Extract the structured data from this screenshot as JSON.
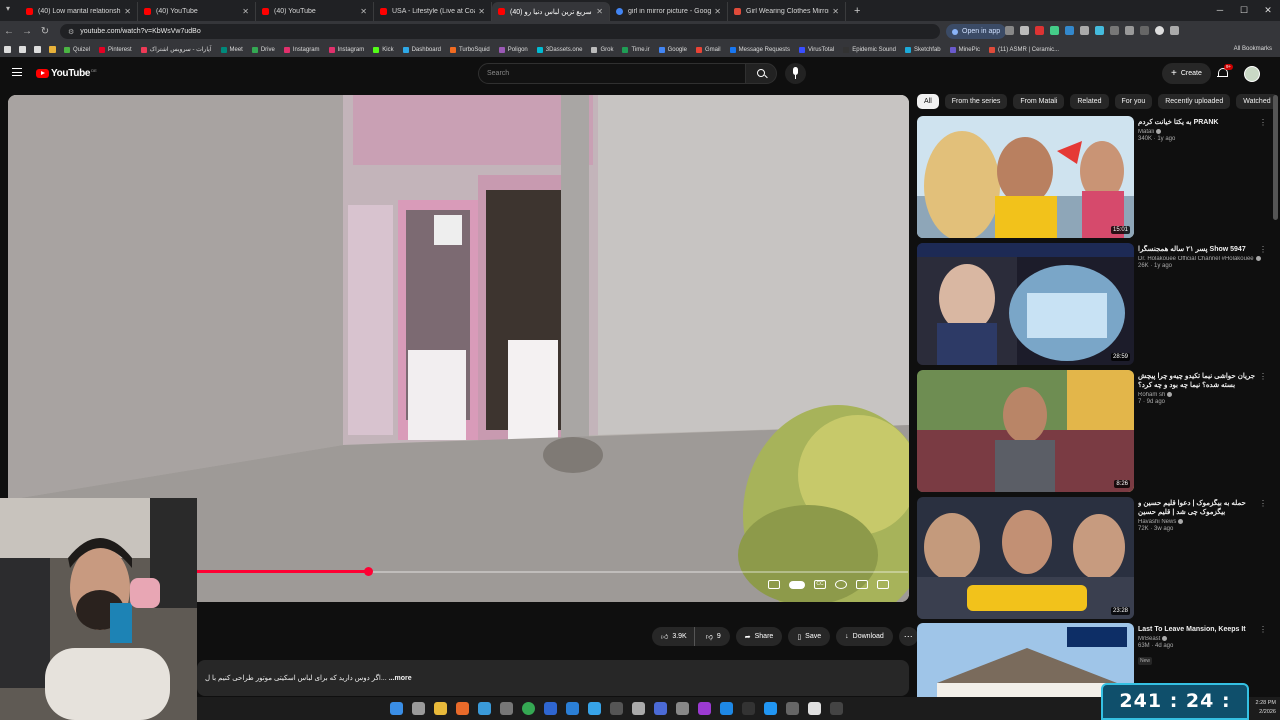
{
  "browser": {
    "tabs": [
      {
        "title": "(40) Low marital relationsh",
        "kind": "yt"
      },
      {
        "title": "(40) YouTube",
        "kind": "yt"
      },
      {
        "title": "(40) YouTube",
        "kind": "yt"
      },
      {
        "title": "USA - Lifestyle (Live at Coachel",
        "kind": "yt"
      },
      {
        "title": "(40) سریع ترین لباس دنیا رو",
        "kind": "yt",
        "active": true
      },
      {
        "title": "girl in mirror picture - Google",
        "kind": "g"
      },
      {
        "title": "Girl Wearing Clothes Mirror Sel",
        "kind": "w"
      }
    ],
    "url": "youtube.com/watch?v=KbWsVw7udBo",
    "open_in_app": "Open in app",
    "bookmarks": [
      "Quizel",
      "Pinterest",
      "آپارات - سرویس اشتراک",
      "Meet",
      "Drive",
      "Instagram",
      "Instagram",
      "Kick",
      "Dashboard",
      "TurboSquid",
      "Poligon",
      "3Dassets.one",
      "Grok",
      "Time.ir",
      "Google",
      "Gmail",
      "Message Requests",
      "VirusTotal",
      "Epidemic Sound",
      "Sketchfab",
      "MinePic",
      "(11) ASMR | Ceramic..."
    ],
    "all_bookmarks": "All Bookmarks"
  },
  "youtube": {
    "logo": "YouTube",
    "logo_country": "DE",
    "search_placeholder": "Search",
    "create_label": "Create",
    "notifications": "9+"
  },
  "video": {
    "progress_fraction": 0.24,
    "likes": "3.9K",
    "dislikes": "9",
    "share": "Share",
    "save": "Save",
    "download": "Download",
    "description": "اگر دوس دارید که برای لباس اسکیتی موتور طراحی کنیم با ل...",
    "more": "...more"
  },
  "sidebar": {
    "chips": [
      "All",
      "From the series",
      "From Matali",
      "Related",
      "For you",
      "Recently uploaded",
      "Watched"
    ],
    "recommendations": [
      {
        "title": "به یکتا خیانت کردم PRANK",
        "channel": "Matali",
        "stats": "340K  ·  1y ago",
        "duration": "15:01"
      },
      {
        "title": "پسر ۲۱ ساله همجنسگرا Show 5947",
        "channel": "Dr. Holakouee Official Channel #Holakouee",
        "stats": "26K  ·  1y ago",
        "duration": "28:59"
      },
      {
        "title": "جریان حواشی نیما تکیدو چیه‌و چرا پیچش بسته شده؟ نیما چه بود و چه کرد؟",
        "channel": "Roham sh",
        "stats": "7  ·  9d ago",
        "duration": "8:26"
      },
      {
        "title": "حمله به بیگزموک | دعوا قلیم حسین و بیگزموک چی شد | قلیم حسین",
        "channel": "Havashi News",
        "stats": "72K  ·  3w ago",
        "duration": "23:28"
      },
      {
        "title": "Last To Leave Mansion, Keeps It",
        "channel": "MrBeast",
        "stats": "63M  ·  4d ago",
        "duration": "",
        "badge": "New"
      }
    ]
  },
  "timer": "241 : 24 : 49",
  "taskbar": {
    "time": "2:28 PM",
    "date": "2/2026"
  },
  "colors": {
    "accent_red": "#ff0033",
    "timer_bg": "#0f4f6b",
    "timer_border": "#35c1e3"
  }
}
